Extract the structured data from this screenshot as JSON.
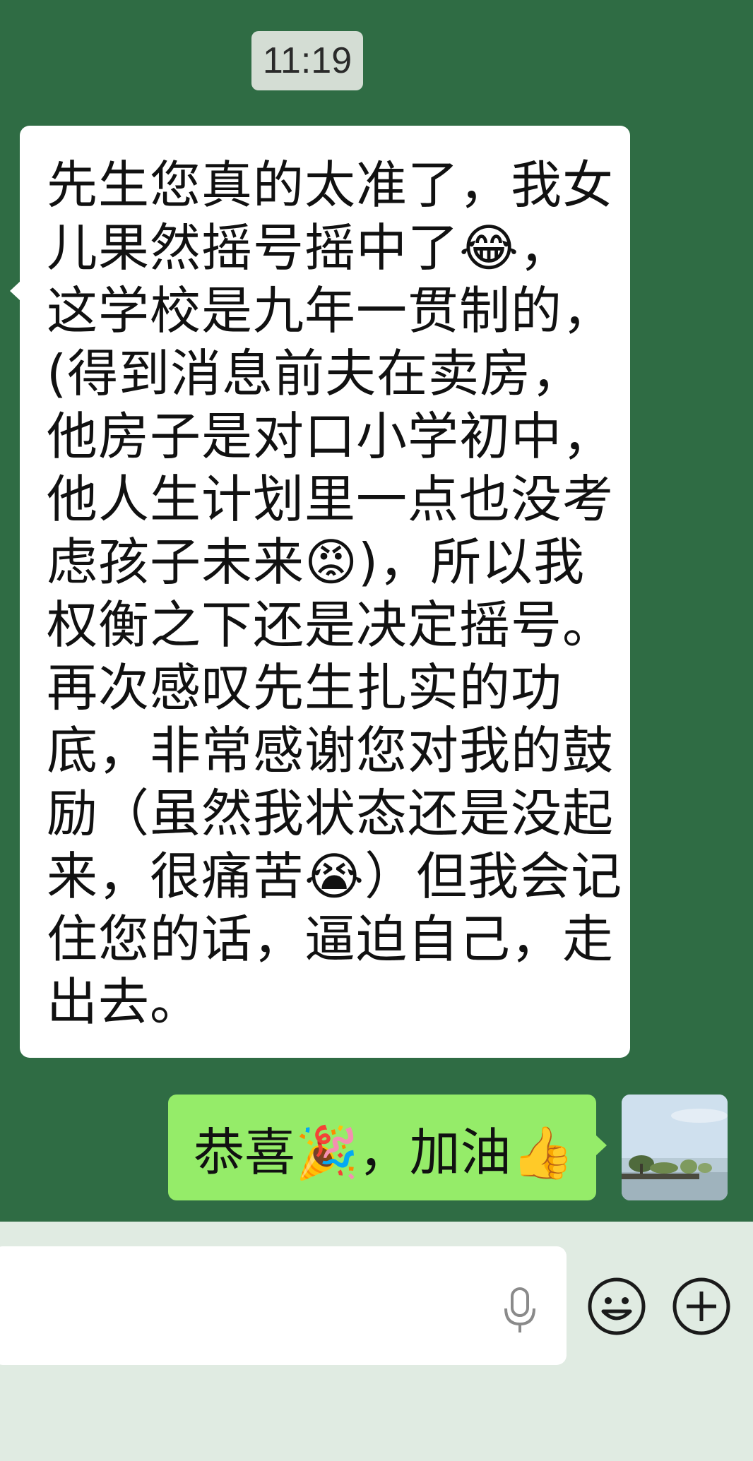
{
  "timestamp": "11:19",
  "incoming_message": {
    "lines": [
      "先生您真的太准了，我女",
      "儿果然摇号摇中了😂，",
      "这学校是九年一贯制的，",
      "(得到消息前夫在卖房，",
      "他房子是对口小学初中，",
      "他人生计划里一点也没考",
      "虑孩子未来😡)，所以我",
      "权衡之下还是决定摇号。",
      "再次感叹先生扎实的功",
      "底，非常感谢您对我的鼓",
      "励（虽然我状态还是没起",
      "来，很痛苦😭）但我会记",
      "住您的话，逼迫自己，走",
      "出去。"
    ]
  },
  "outgoing_message": {
    "text": "恭喜🎉，加油👍"
  },
  "input_bar": {
    "placeholder": ""
  },
  "icons": {
    "mic": "microphone-icon",
    "emoji": "emoji-icon",
    "plus": "plus-icon"
  },
  "colors": {
    "chat_background": "#2f6c44",
    "incoming_bubble": "#ffffff",
    "outgoing_bubble": "#95ec69",
    "input_bar_background": "#e0ebe2"
  }
}
